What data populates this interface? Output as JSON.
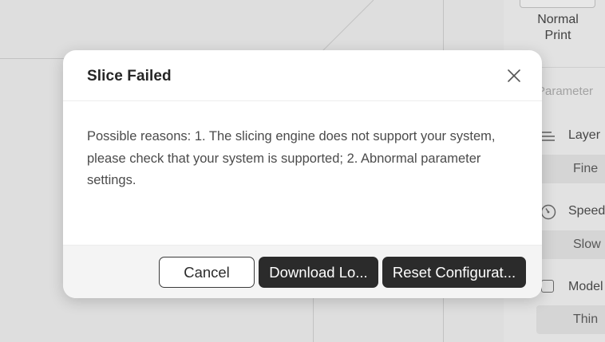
{
  "side_panel": {
    "mode_label": "Normal\nPrint",
    "section_title": "Parameter",
    "rows": [
      {
        "label": "Layer",
        "value": "Fine",
        "icon": "layer-lines-icon"
      },
      {
        "label": "Speed",
        "value": "Slow",
        "icon": "speedometer-icon"
      },
      {
        "label": "Model",
        "value": "Thin",
        "icon": "checkbox-icon"
      }
    ]
  },
  "dialog": {
    "title": "Slice Failed",
    "message": "Possible reasons: 1. The slicing engine does not support your system, please check that your system is supported; 2. Abnormal parameter settings.",
    "buttons": {
      "cancel": "Cancel",
      "download": "Download Lo...",
      "reset": "Reset Configurat..."
    },
    "close_icon": "close-icon"
  },
  "colors": {
    "primary_button": "#2b2b2b",
    "dialog_bg": "#ffffff",
    "footer_bg": "#f4f4f4"
  }
}
